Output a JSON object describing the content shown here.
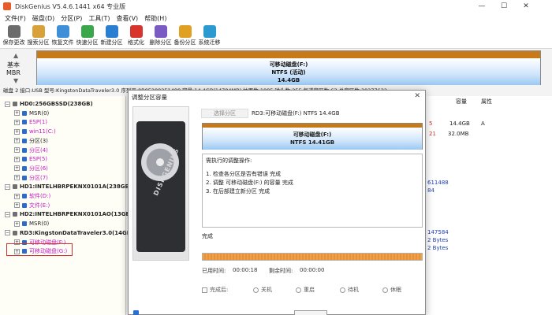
{
  "window": {
    "title": "DiskGenius V5.4.6.1441 x64 专业版",
    "min": "—",
    "max": "☐",
    "close": "✕"
  },
  "menu": [
    "文件(F)",
    "磁盘(D)",
    "分区(P)",
    "工具(T)",
    "查看(V)",
    "帮助(H)"
  ],
  "toolbar": [
    {
      "label": "保存更改",
      "icon": "save-icon",
      "color": "#6b6b6b"
    },
    {
      "label": "搜索分区",
      "icon": "search-icon",
      "color": "#d9a13a"
    },
    {
      "label": "恢复文件",
      "icon": "recover-icon",
      "color": "#3e8fd8"
    },
    {
      "label": "快速分区",
      "icon": "quick-partition-icon",
      "color": "#3aa84a"
    },
    {
      "label": "新建分区",
      "icon": "new-partition-icon",
      "color": "#2b7fd0"
    },
    {
      "label": "格式化",
      "icon": "format-icon",
      "color": "#d7342b"
    },
    {
      "label": "删除分区",
      "icon": "delete-partition-icon",
      "color": "#7a5bc4"
    },
    {
      "label": "备份分区",
      "icon": "backup-partition-icon",
      "color": "#e0a022"
    },
    {
      "label": "系统迁移",
      "icon": "migrate-icon",
      "color": "#2a9ad0"
    }
  ],
  "disk_panel": {
    "type_line1": "基本",
    "type_line2": "MBR",
    "partition_name": "可移动磁盘(F:)",
    "partition_fs": "NTFS (活动)",
    "partition_size": "14.4GB"
  },
  "info_line": "磁盘 2 接口:USB 型号:KingstonDataTraveler3.0 序列号:0B05209251488 容量:14.4GB(14784MB) 柱面数:1885 磁头数:255 每道扇区数:63 总扇区数:30277632",
  "tree": [
    {
      "label": "HD0:256GBSSD(238GB)",
      "level": 0,
      "type": "disk",
      "color": "#222"
    },
    {
      "label": "MSR(0)",
      "level": 1,
      "type": "part",
      "color": "#222"
    },
    {
      "label": "ESP(1)",
      "level": 1,
      "type": "part",
      "color": "#c21bc2"
    },
    {
      "label": "win11(C:)",
      "level": 1,
      "type": "part",
      "color": "#c21bc2"
    },
    {
      "label": "分区(3)",
      "level": 1,
      "type": "part",
      "color": "#222"
    },
    {
      "label": "分区(4)",
      "level": 1,
      "type": "part",
      "color": "#c21bc2"
    },
    {
      "label": "ESP(5)",
      "level": 1,
      "type": "part",
      "color": "#c21bc2"
    },
    {
      "label": "分区(6)",
      "level": 1,
      "type": "part",
      "color": "#c21bc2"
    },
    {
      "label": "分区(7)",
      "level": 1,
      "type": "part",
      "color": "#c21bc2"
    },
    {
      "label": "HD1:INTELHBRPEKNX0101A(238GB)",
      "level": 0,
      "type": "disk",
      "color": "#222"
    },
    {
      "label": "软件(D:)",
      "level": 1,
      "type": "part",
      "color": "#c21bc2"
    },
    {
      "label": "文件(E:)",
      "level": 1,
      "type": "part",
      "color": "#c21bc2"
    },
    {
      "label": "HD2:INTELHBRPEKNX0101AO(13GB)",
      "level": 0,
      "type": "disk",
      "color": "#222"
    },
    {
      "label": "MSR(0)",
      "level": 1,
      "type": "part",
      "color": "#222"
    },
    {
      "label": "RD3:KingstonDataTraveler3.0(14GB)",
      "level": 0,
      "type": "disk",
      "color": "#222"
    },
    {
      "label": "可移动磁盘(F:)",
      "level": 1,
      "type": "part",
      "color": "#c21bc2"
    },
    {
      "label": "可移动磁盘(G:)",
      "level": 1,
      "type": "part",
      "color": "#c21bc2"
    }
  ],
  "right_panel": {
    "headers": [
      "容量",
      "属性"
    ],
    "row1": {
      "num": "5",
      "cap": "14.4GB",
      "attr": "A"
    },
    "row2": {
      "num": "21",
      "cap": "32.0MB"
    },
    "vals_a": [
      "611488",
      "84"
    ],
    "vals_b": [
      "147584",
      "2 Bytes",
      "2 Bytes"
    ]
  },
  "dialog": {
    "title": "调整分区容量",
    "close": "✕",
    "brand": "DISKGENIUS",
    "tab_select": "选择分区",
    "tab_partition": "RD3:可移动磁盘(F:) NTFS 14.4GB",
    "bar_name": "可移动磁盘(F:)",
    "bar_info": "NTFS 14.41GB",
    "log_title": "需执行的调整操作:",
    "log_lines": [
      "1. 检查各分区是否有错误    完成",
      "2. 调整 可移动磁盘(F:) 的容量    完成",
      "3. 在后部建立新分区    完成"
    ],
    "status": "完成",
    "progress": 1.0,
    "elapsed_label": "已用时间:",
    "elapsed_value": "00:00:18",
    "remaining_label": "剩余时间:",
    "remaining_value": "00:00:00",
    "after_label": "完成后:",
    "after_options": [
      "关机",
      "重启",
      "待机",
      "休眠"
    ]
  }
}
